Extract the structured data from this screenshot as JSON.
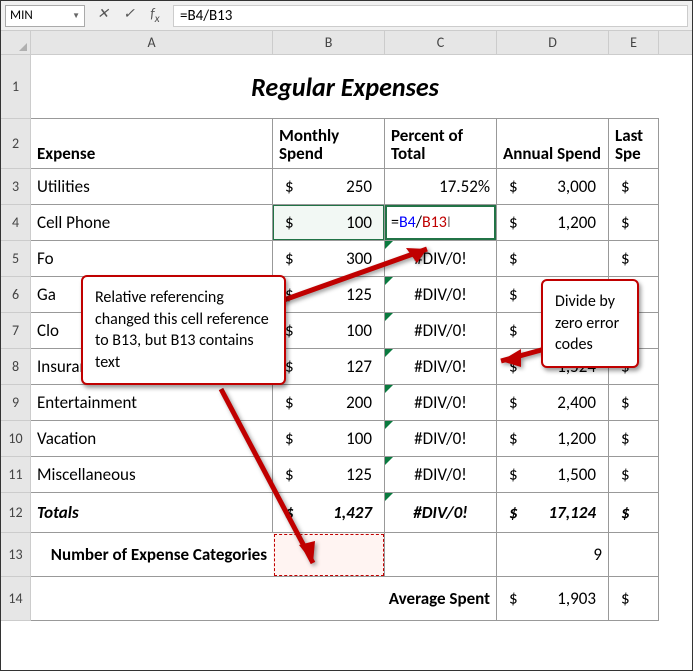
{
  "name_box": "MIN",
  "formula_bar": "=B4/B13",
  "columns": [
    "A",
    "B",
    "C",
    "D",
    "E"
  ],
  "title": "Regular Expenses",
  "headers": {
    "expense": "Expense",
    "monthly": "Monthly Spend",
    "percent": "Percent of Total",
    "annual": "Annual Spend",
    "last": "Last Spe"
  },
  "currency": "$",
  "rows": [
    {
      "n": "3",
      "label": "Utilities",
      "monthly": "250",
      "percent": "17.52%",
      "annual": "3,000"
    },
    {
      "n": "4",
      "label": "Cell Phone",
      "monthly": "100",
      "percent_formula": {
        "prefix": "=",
        "b": "B4",
        "slash": "/",
        "r": "B13"
      },
      "annual": "1,200"
    },
    {
      "n": "5",
      "label": "Fo",
      "monthly": "300",
      "percent": "#DIV/0!",
      "annual": ""
    },
    {
      "n": "6",
      "label": "Ga",
      "monthly": "125",
      "percent": "#DIV/0!",
      "annual": ""
    },
    {
      "n": "7",
      "label": "Clo",
      "monthly": "100",
      "percent": "#DIV/0!",
      "annual": ""
    },
    {
      "n": "8",
      "label": "Insurance",
      "monthly": "127",
      "percent": "#DIV/0!",
      "annual": "1,524"
    },
    {
      "n": "9",
      "label": "Entertainment",
      "monthly": "200",
      "percent": "#DIV/0!",
      "annual": "2,400"
    },
    {
      "n": "10",
      "label": "Vacation",
      "monthly": "100",
      "percent": "#DIV/0!",
      "annual": "1,200"
    },
    {
      "n": "11",
      "label": "Miscellaneous",
      "monthly": "125",
      "percent": "#DIV/0!",
      "annual": "1,500"
    }
  ],
  "totals": {
    "n": "12",
    "label": "Totals",
    "monthly": "1,427",
    "percent": "#DIV/0!",
    "annual": "17,124"
  },
  "row13": {
    "n": "13",
    "label": "Number of Expense Categories",
    "value": "9"
  },
  "row14": {
    "n": "14",
    "label": "Average Spent",
    "value": "1,903"
  },
  "callout1": "Relative referencing changed this cell reference to B13, but B13 contains text",
  "callout2": "Divide by zero error codes",
  "chart_data": {
    "type": "table",
    "title": "Regular Expenses",
    "columns": [
      "Expense",
      "Monthly Spend",
      "Percent of Total",
      "Annual Spend"
    ],
    "rows": [
      [
        "Utilities",
        250,
        "17.52%",
        3000
      ],
      [
        "Cell Phone",
        100,
        "=B4/B13",
        1200
      ],
      [
        "Food",
        300,
        "#DIV/0!",
        null
      ],
      [
        "Gas",
        125,
        "#DIV/0!",
        null
      ],
      [
        "Clothes",
        100,
        "#DIV/0!",
        null
      ],
      [
        "Insurance",
        127,
        "#DIV/0!",
        1524
      ],
      [
        "Entertainment",
        200,
        "#DIV/0!",
        2400
      ],
      [
        "Vacation",
        100,
        "#DIV/0!",
        1200
      ],
      [
        "Miscellaneous",
        125,
        "#DIV/0!",
        1500
      ]
    ],
    "totals": [
      "Totals",
      1427,
      "#DIV/0!",
      17124
    ],
    "extra": {
      "Number of Expense Categories": 9,
      "Average Spent": 1903
    }
  }
}
